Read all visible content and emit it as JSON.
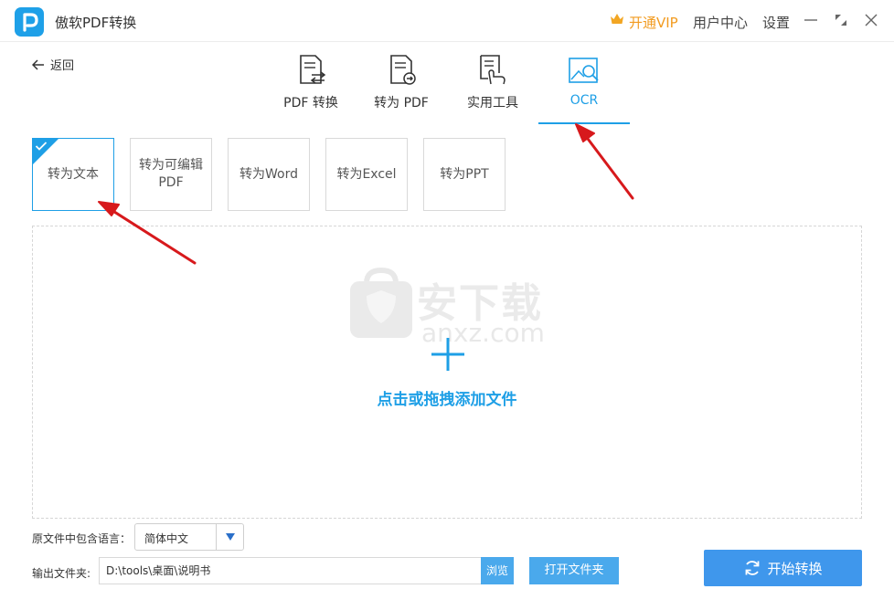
{
  "titlebar": {
    "app_title": "傲软PDF转换",
    "vip_label": "开通VIP",
    "user_center_label": "用户中心",
    "settings_label": "设置"
  },
  "nav": {
    "back_label": "返回"
  },
  "tabs": [
    {
      "label": "PDF 转换"
    },
    {
      "label": "转为 PDF"
    },
    {
      "label": "实用工具"
    },
    {
      "label": "OCR"
    }
  ],
  "ocr_options": [
    {
      "label": "转为文本",
      "selected": true
    },
    {
      "label": "转为可编辑PDF",
      "selected": false
    },
    {
      "label": "转为Word",
      "selected": false
    },
    {
      "label": "转为Excel",
      "selected": false
    },
    {
      "label": "转为PPT",
      "selected": false
    }
  ],
  "dropzone": {
    "text": "点击或拖拽添加文件",
    "watermark_title": "安下载",
    "watermark_sub": "anxz.com"
  },
  "language": {
    "label": "原文件中包含语言：",
    "selected": "简体中文"
  },
  "output": {
    "label": "输出文件夹:",
    "path": "D:\\tools\\桌面\\说明书",
    "browse_label": "浏览",
    "open_folder_label": "打开文件夹"
  },
  "start_button_label": "开始转换",
  "colors": {
    "accent": "#1e9fe6",
    "vip": "#f29b20",
    "button": "#4aa9ec",
    "start_button": "#3f97ec",
    "annotation_arrow": "#d7191c"
  }
}
